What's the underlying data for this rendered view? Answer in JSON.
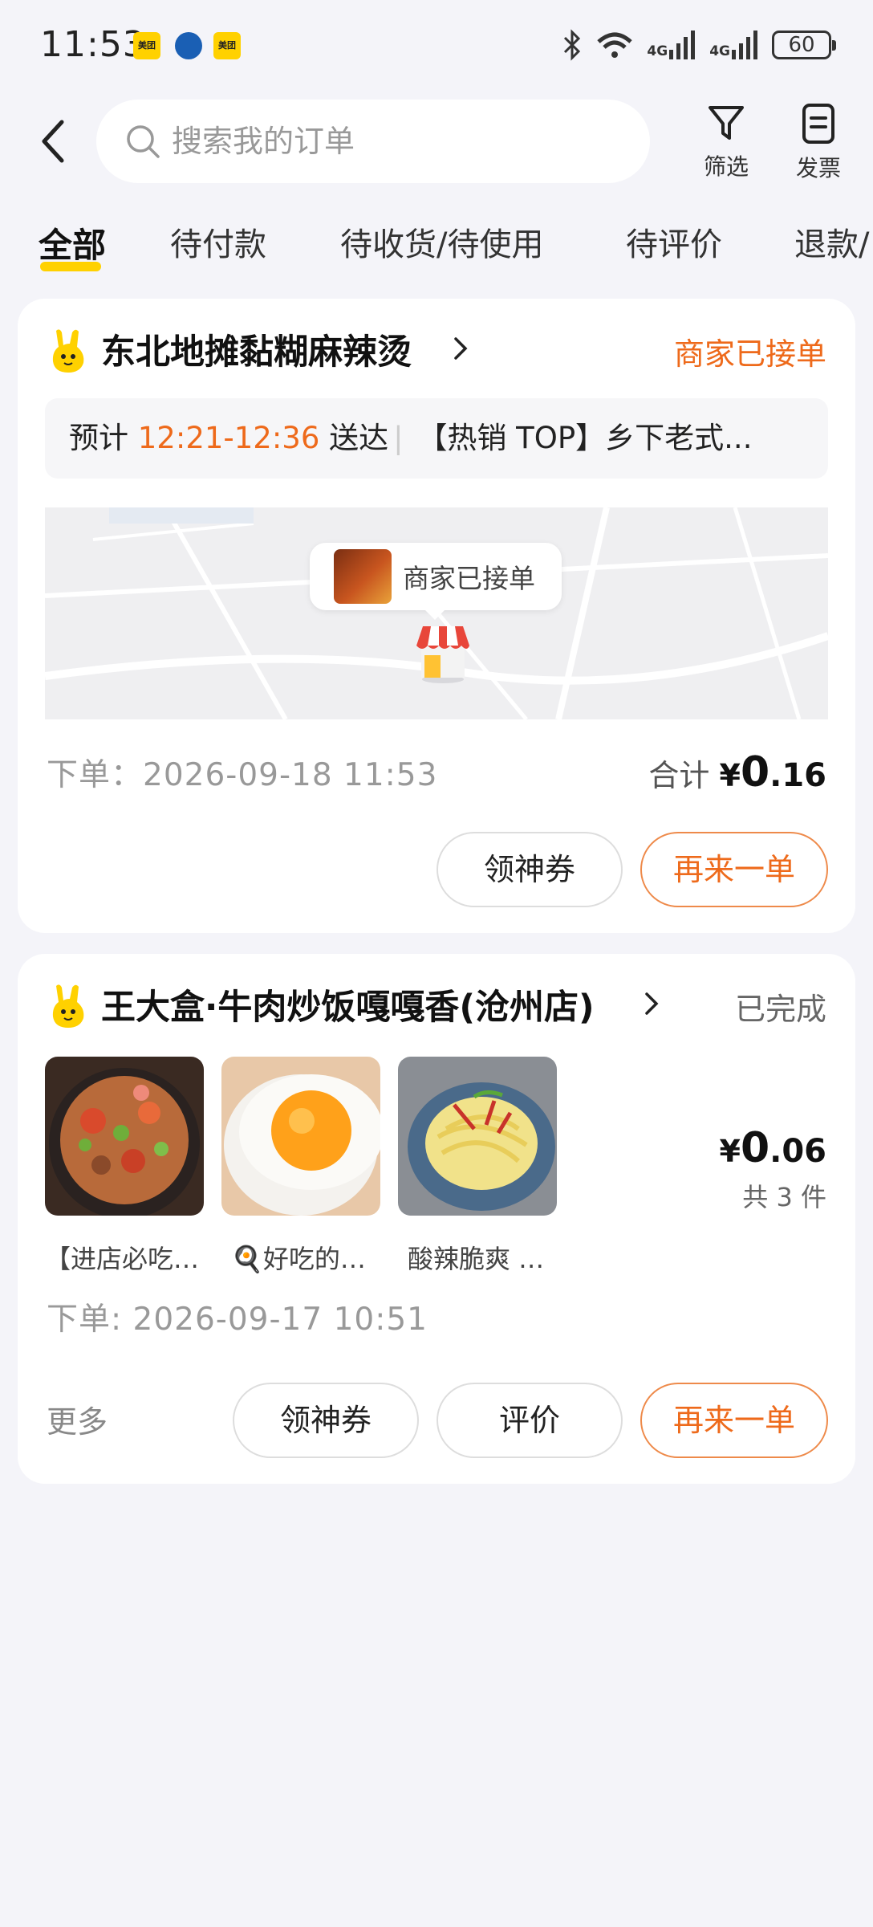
{
  "status_bar": {
    "time": "11:53",
    "apps": [
      "美团",
      "美团"
    ],
    "network": [
      "4G",
      "4G"
    ],
    "battery": "60"
  },
  "header": {
    "search_placeholder": "搜索我的订单",
    "filter_label": "筛选",
    "invoice_label": "发票"
  },
  "tabs": [
    {
      "label": "全部",
      "active": true
    },
    {
      "label": "待付款"
    },
    {
      "label": "待收货/待使用"
    },
    {
      "label": "待评价"
    },
    {
      "label": "退款/"
    }
  ],
  "orders": [
    {
      "store": "东北地摊黏糊麻辣烫",
      "status": "商家已接单",
      "eta_prefix": "预计",
      "eta_time": "12:21-12:36",
      "eta_suffix": "送达",
      "item_summary": "【热销 TOP】乡下老式...",
      "map_bubble": "商家已接单",
      "order_time": "下单：2026-09-18 11:53",
      "total_label": "合计",
      "price_symbol": "¥",
      "price_int": "0",
      "price_dec": ".16",
      "buttons": {
        "coupon": "领神券",
        "reorder": "再来一单"
      }
    },
    {
      "store": "王大盒·牛肉炒饭嘎嘎香(沧州店)",
      "status": "已完成",
      "items": [
        {
          "caption": "【进店必吃…"
        },
        {
          "caption": "🍳好吃的…"
        },
        {
          "caption": "酸辣脆爽 …"
        }
      ],
      "price_symbol": "¥",
      "price_int": "0",
      "price_dec": ".06",
      "count": "共 3 件",
      "order_time": "下单: 2026-09-17 10:51",
      "more": "更多",
      "buttons": {
        "coupon": "领神券",
        "review": "评价",
        "reorder": "再来一单"
      }
    }
  ],
  "colors": {
    "accent": "#ffd100",
    "orange": "#ee6a1b",
    "background": "#f4f4f9"
  }
}
